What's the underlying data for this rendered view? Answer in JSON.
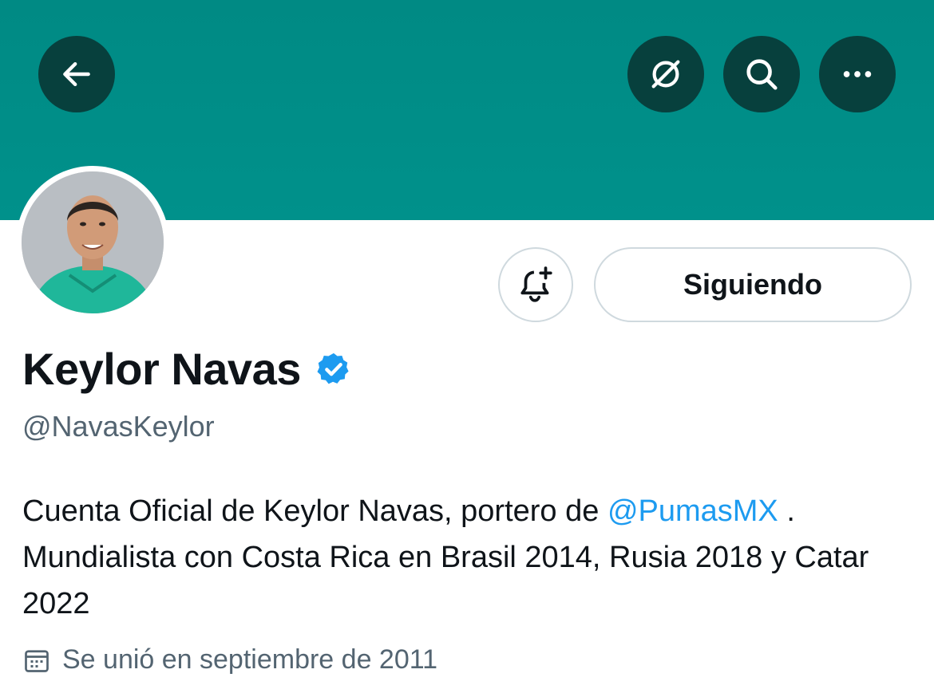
{
  "header": {
    "back_icon": "arrow-left-icon",
    "actions": [
      "grok-icon",
      "search-icon",
      "more-icon"
    ],
    "banner_color": "#008f89",
    "button_color": "#07403d"
  },
  "profile": {
    "name": "Keylor Navas",
    "verified": true,
    "verified_color": "#1d9bf0",
    "handle": "@NavasKeylor",
    "bio_part1": "Cuenta Oficial de Keylor Navas, portero de ",
    "bio_mention": "@PumasMX",
    "bio_part2": " . Mundialista con Costa Rica en Brasil 2014, Rusia 2018 y Catar 2022",
    "joined": "Se unió en septiembre de 2011"
  },
  "buttons": {
    "follow_label": "Siguiendo",
    "notify_icon": "bell-plus-icon"
  }
}
